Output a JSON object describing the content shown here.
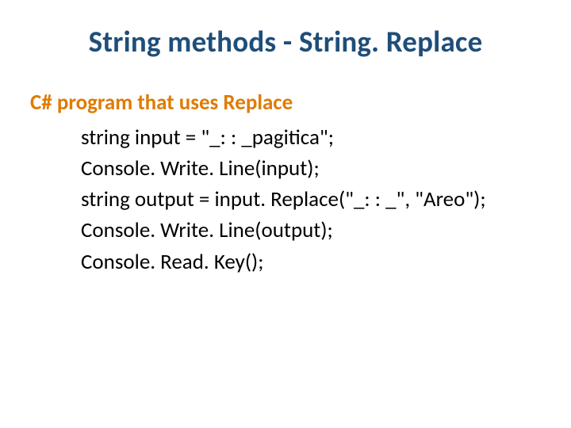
{
  "title": "String methods - String. Replace",
  "subtitle": "C# program that uses Replace",
  "code": {
    "line1": "string input = \"_: : _pagitica\";",
    "line2": "Console. Write. Line(input);",
    "line3": "string output = input. Replace(\"_: : _\", \"Areo\");",
    "line4": "Console. Write. Line(output);",
    "line5": "Console. Read. Key();"
  }
}
